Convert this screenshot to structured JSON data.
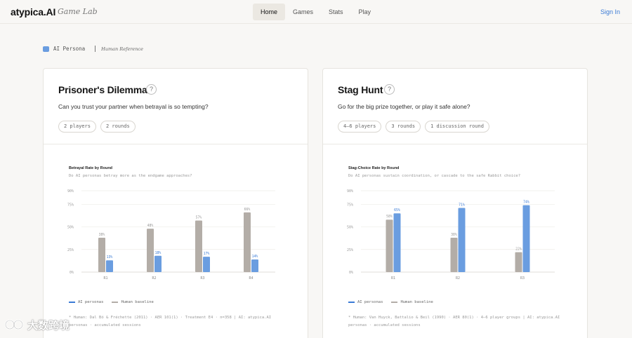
{
  "nav": {
    "brand": "atypica.AI",
    "brand_sub": "Game Lab",
    "items": [
      {
        "label": "Home",
        "active": true
      },
      {
        "label": "Games",
        "active": false
      },
      {
        "label": "Stats",
        "active": false
      },
      {
        "label": "Play",
        "active": false
      }
    ],
    "sign_in": "Sign In"
  },
  "legend": {
    "ai": "AI Persona",
    "human": "Human Reference",
    "ai_color": "#6a9de0"
  },
  "colors": {
    "ai": "#6a9de0",
    "human": "#b3ada7",
    "accent": "#3b7bd6"
  },
  "cards": [
    {
      "title": "Prisoner's Dilemma",
      "help": "?",
      "description": "Can you trust your partner when betrayal is so tempting?",
      "tags": [
        "2 players",
        "2 rounds"
      ],
      "chart_title": "Betrayal Rate by Round",
      "chart_subtitle": "Do AI personas betray more as the endgame approaches?",
      "legend_ai": "AI personas",
      "legend_human": "Human baseline",
      "source": "*  Human: Dal Bó & Fréchette (2011) · AER 101(1) · Treatment E4 · n=358  |  AI: atypica.AI personas · accumulated sessions"
    },
    {
      "title": "Stag Hunt",
      "help": "?",
      "description": "Go for the big prize together, or play it safe alone?",
      "tags": [
        "4–6 players",
        "3 rounds",
        "1 discussion round"
      ],
      "chart_title": "Stag-Choice Rate by Round",
      "chart_subtitle": "Do AI personas sustain coordination, or cascade to the safe Rabbit choice?",
      "legend_ai": "AI personas",
      "legend_human": "Human baseline",
      "source": "*  Human: Van Huyck, Battalio & Beil (1990) · AER 80(1) · 4–6 player groups  |  AI: atypica.AI personas · accumulated sessions"
    }
  ],
  "chart_data": [
    {
      "type": "bar",
      "title": "Betrayal Rate by Round",
      "subtitle": "Do AI personas betray more as the endgame approaches?",
      "categories": [
        "R1",
        "R2",
        "R3",
        "R4"
      ],
      "series": [
        {
          "name": "Human baseline",
          "values": [
            38,
            48,
            57,
            66
          ]
        },
        {
          "name": "AI personas",
          "values": [
            13,
            18,
            17,
            14
          ]
        }
      ],
      "value_labels": {
        "Human baseline": [
          "38%",
          "48%",
          "57%",
          "66%"
        ],
        "AI personas": [
          "13%",
          "18%",
          "17%",
          "14%"
        ]
      },
      "y_ticks": [
        "0%",
        "25%",
        "50%",
        "75%",
        "90%"
      ],
      "y_tick_values": [
        0,
        25,
        50,
        75,
        90
      ],
      "ylim": [
        0,
        90
      ],
      "grid": true,
      "legend": "bottom-left"
    },
    {
      "type": "bar",
      "title": "Stag-Choice Rate by Round",
      "subtitle": "Do AI personas sustain coordination, or cascade to the safe Rabbit choice?",
      "categories": [
        "R1",
        "R2",
        "R3"
      ],
      "series": [
        {
          "name": "Human baseline",
          "values": [
            58,
            38,
            22
          ]
        },
        {
          "name": "AI personas",
          "values": [
            65,
            71,
            74
          ]
        }
      ],
      "value_labels": {
        "Human baseline": [
          "58%",
          "38%",
          "22%"
        ],
        "AI personas": [
          "65%",
          "71%",
          "74%"
        ]
      },
      "y_ticks": [
        "0%",
        "25%",
        "50%",
        "75%",
        "90%"
      ],
      "y_tick_values": [
        0,
        25,
        50,
        75,
        90
      ],
      "ylim": [
        0,
        90
      ],
      "grid": true,
      "legend": "bottom-left"
    }
  ],
  "watermark": {
    "text": "大数跨境"
  }
}
